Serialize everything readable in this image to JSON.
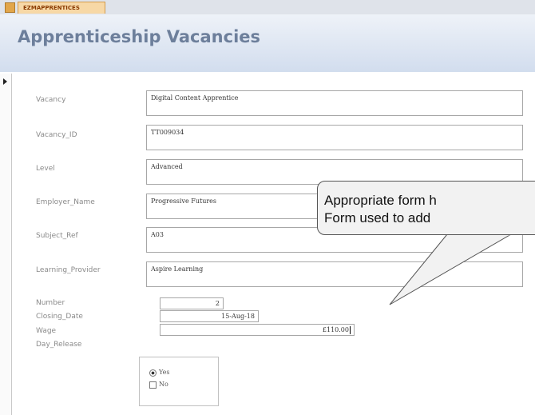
{
  "tab": {
    "label": "EZMAPPRENTICES"
  },
  "header": {
    "title": "Apprenticeship Vacancies"
  },
  "fields": {
    "vacancy": {
      "label": "Vacancy",
      "value": "Digital Content Apprentice"
    },
    "vacancy_id": {
      "label": "Vacancy_ID",
      "value": "TT009034"
    },
    "level": {
      "label": "Level",
      "value": "Advanced"
    },
    "employer_name": {
      "label": "Employer_Name",
      "value": "Progressive Futures"
    },
    "subject_ref": {
      "label": "Subject_Ref",
      "value": "A03"
    },
    "learning_provider": {
      "label": "Learning_Provider",
      "value": "Aspire Learning"
    },
    "number": {
      "label": "Number",
      "value": "2"
    },
    "closing_date": {
      "label": "Closing_Date",
      "value": "15-Aug-18"
    },
    "wage": {
      "label": "Wage",
      "value": "£110.00"
    },
    "day_release": {
      "label": "Day_Release",
      "options": [
        {
          "label": "Yes",
          "selected": true
        },
        {
          "label": "No",
          "selected": false
        }
      ]
    }
  },
  "callout": {
    "line1": "Appropriate form h",
    "line2": "Form used to add"
  },
  "colors": {
    "header_title": "#6d7f9b",
    "tab_bg": "#f7d8a6",
    "label_text": "#8a8a8a",
    "callout_bg": "#f2f2f2"
  }
}
